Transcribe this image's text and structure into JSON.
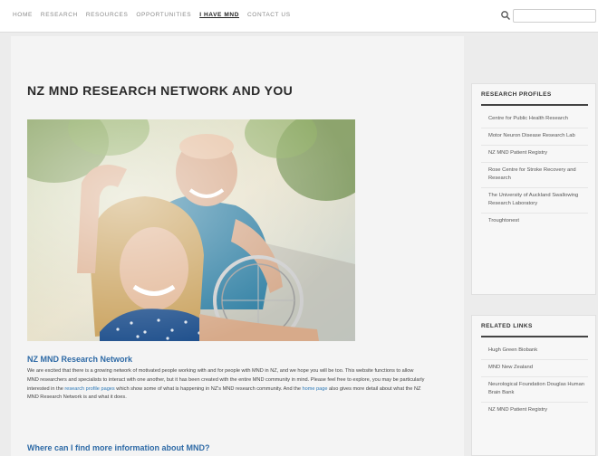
{
  "nav": {
    "items": [
      "HOME",
      "RESEARCH",
      "RESOURCES",
      "OPPORTUNITIES",
      "I HAVE MND",
      "CONTACT US"
    ],
    "active_index": 4
  },
  "search": {
    "icon": "search-icon",
    "placeholder": ""
  },
  "main": {
    "title": "NZ MND RESEARCH NETWORK AND YOU",
    "hero_image": "photo-smiling-woman-and-man-in-wheelchair",
    "section_heading": "NZ MND Research Network",
    "intro_part1": "We are excited that there is a growing network of motivated people working with and for people with MND in NZ, and we hope you will be too. This website functions to allow MND researchers and specialists to interact with one another, but it has been created with the entire MND community in mind. Please feel free to explore, you may be particularly interested in the ",
    "intro_link1": "research profile pages",
    "intro_part2": " which show some of what is happening in NZ's MND research community. And the ",
    "intro_link2": "home page",
    "intro_part3": " also gives more detail about what the NZ MND Research Network is and what it does.",
    "section_heading_2": "Where can I find more information about MND?"
  },
  "sidebar": {
    "research_profiles": {
      "title": "RESEARCH PROFILES",
      "items": [
        "Centre for Public Health Research",
        "Motor Neuron Disease Research Lab",
        "NZ MND Patient Registry",
        "Rose Centre for Stroke Recovery and Research",
        "The University of Auckland Swallowing Research Laboratory",
        "Troughtonest"
      ]
    },
    "related_links": {
      "title": "RELATED LINKS",
      "items": [
        "Hugh Green Biobank",
        "MND New Zealand",
        "Neurological Foundation Douglas Human Brain Bank",
        "NZ MND Patient Registry"
      ]
    }
  },
  "colors": {
    "link": "#2e7ab8",
    "heading": "#2e6aa6"
  }
}
